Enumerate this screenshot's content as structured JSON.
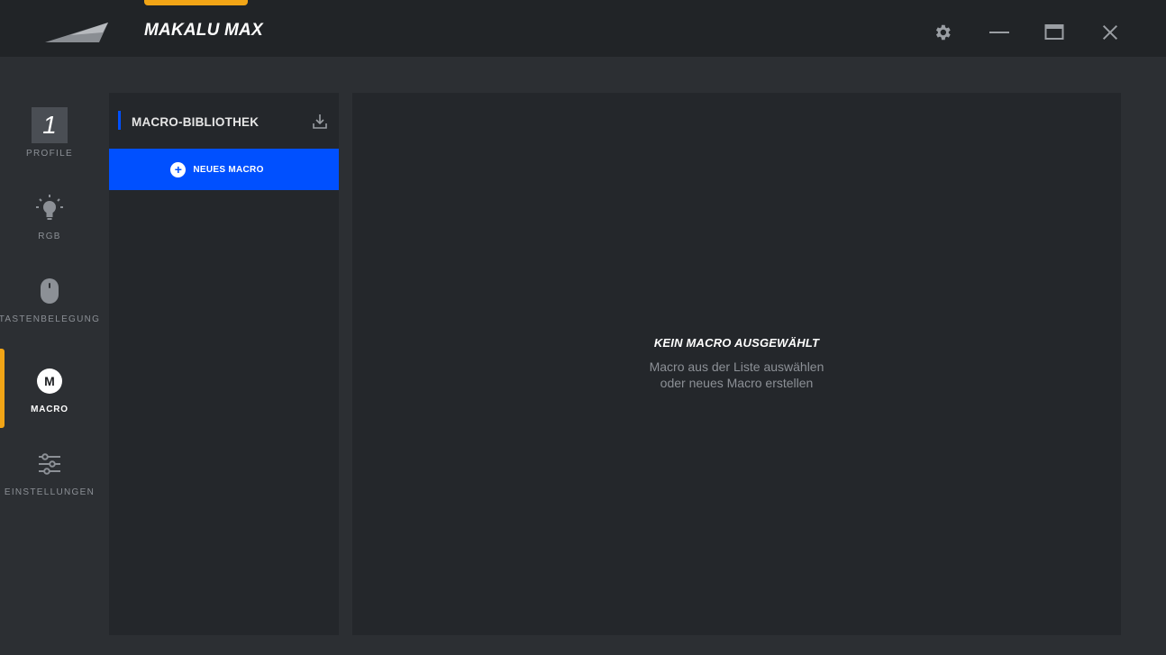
{
  "window": {
    "title": "MAKALU MAX",
    "logo_icon": "mountain-logo-icon",
    "controls": [
      "gear-icon",
      "minimize-icon",
      "maximize-icon",
      "close-icon"
    ],
    "accent_color": "#f2a516"
  },
  "sidebar": {
    "items": [
      {
        "label": "PROFILE",
        "icon": "profile-number",
        "value": "1",
        "active": false
      },
      {
        "label": "RGB",
        "icon": "lightbulb-icon",
        "active": false
      },
      {
        "label": "TASTENBELEGUNG",
        "icon": "mouse-icon",
        "active": false
      },
      {
        "label": "MACRO",
        "icon": "macro-icon",
        "icon_text": "M",
        "active": true
      },
      {
        "label": "EINSTELLUNGEN",
        "icon": "sliders-icon",
        "active": false
      }
    ]
  },
  "library": {
    "title": "MACRO-BIBLIOTHEK",
    "import_icon": "import-icon",
    "new_button": {
      "label": "NEUES MACRO",
      "icon": "plus-icon",
      "color": "#0050ff"
    }
  },
  "main": {
    "empty_title": "KEIN MACRO AUSGEWÄHLT",
    "empty_line1": "Macro aus der Liste auswählen",
    "empty_line2": "oder neues Macro erstellen"
  }
}
